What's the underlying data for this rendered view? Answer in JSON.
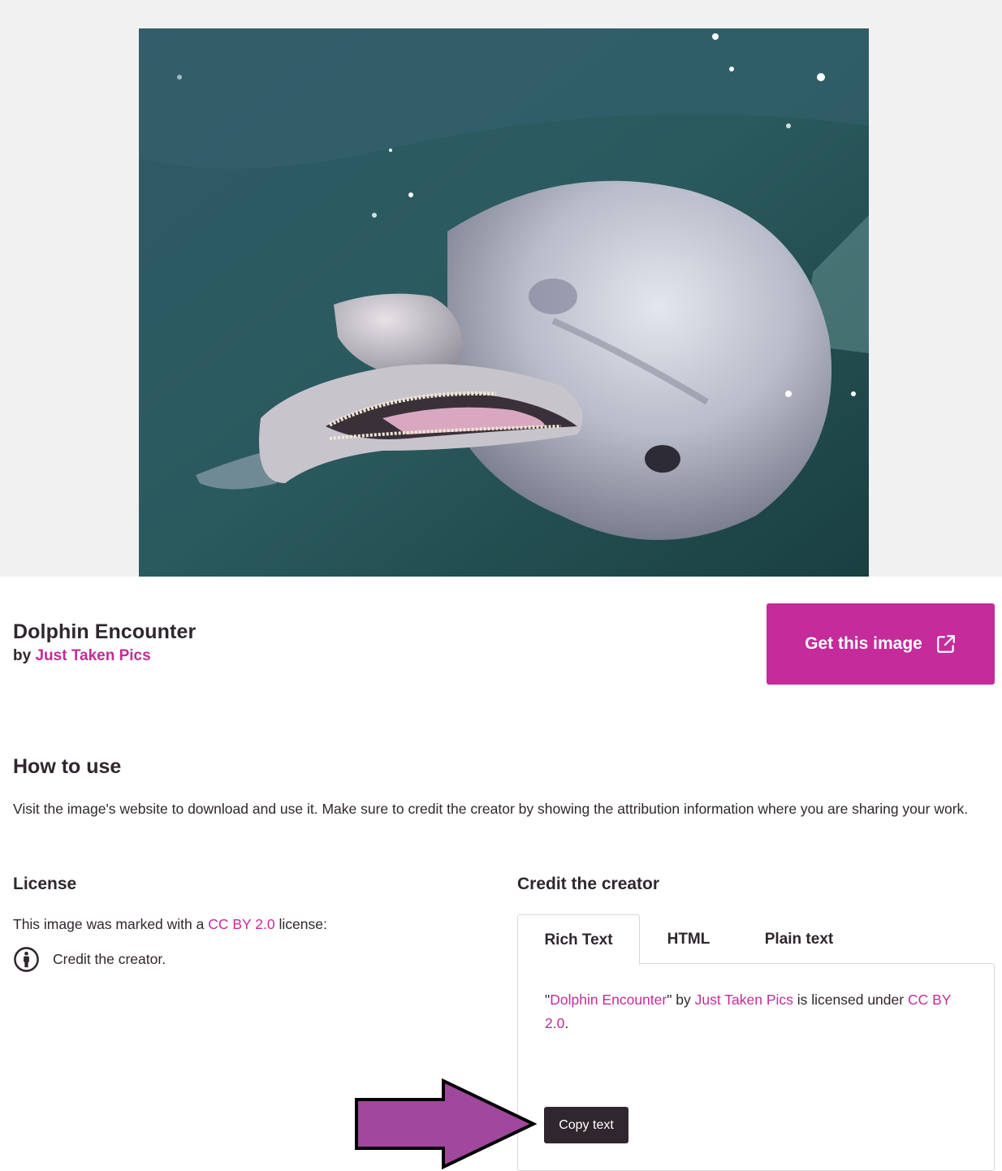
{
  "image": {
    "alt": "Dolphin Encounter"
  },
  "header": {
    "title": "Dolphin Encounter",
    "by_prefix": "by",
    "creator": "Just Taken Pics",
    "get_image_label": "Get this image",
    "get_image_icon": "external-link-icon"
  },
  "how_to_use": {
    "heading": "How to use",
    "body": "Visit the image's website to download and use it. Make sure to credit the creator by showing the attribution information where you are sharing your work."
  },
  "license": {
    "heading": "License",
    "text_prefix": "This image was marked with a",
    "license_name": "CC BY 2.0",
    "text_suffix": "license:",
    "requirements": [
      {
        "icon": "cc-by-attribution-icon",
        "label": "Credit the creator."
      }
    ]
  },
  "credit": {
    "heading": "Credit the creator",
    "tabs": [
      {
        "label": "Rich Text",
        "active": true
      },
      {
        "label": "HTML",
        "active": false
      },
      {
        "label": "Plain text",
        "active": false
      }
    ],
    "attribution": {
      "open_quote": "\"",
      "title": "Dolphin Encounter",
      "close_quote_by": "\" by ",
      "creator": "Just Taken Pics",
      "licensed_under": " is licensed under ",
      "license": "CC BY 2.0",
      "end": "."
    },
    "copy_label": "Copy text"
  },
  "annotation": {
    "type": "arrow",
    "points_to": "Copy text",
    "color": "#a0479e"
  },
  "colors": {
    "accent": "#c52b9b",
    "text": "#30272e",
    "hero_bg": "#f1f1f1",
    "border": "#d8d8d8"
  }
}
